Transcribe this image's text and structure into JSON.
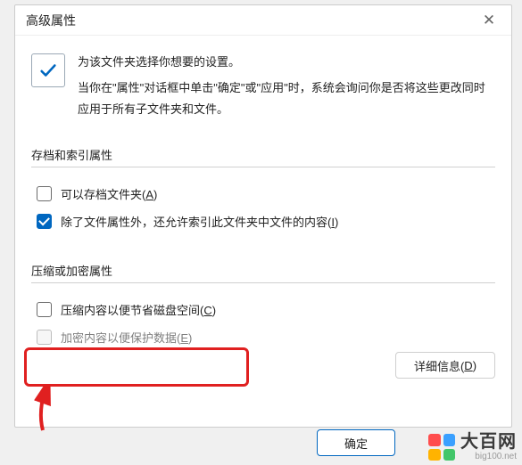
{
  "dialog": {
    "title": "高级属性",
    "intro_line1": "为该文件夹选择你想要的设置。",
    "intro_line2": "当你在\"属性\"对话框中单击\"确定\"或\"应用\"时，系统会询问你是否将这些更改同时应用于所有子文件夹和文件。"
  },
  "group1": {
    "label": "存档和索引属性",
    "chk1": {
      "text": "可以存档文件夹(",
      "accel": "A",
      "suffix": ")",
      "checked": false
    },
    "chk2": {
      "text": "除了文件属性外，还允许索引此文件夹中文件的内容(",
      "accel": "I",
      "suffix": ")",
      "checked": true
    }
  },
  "group2": {
    "label": "压缩或加密属性",
    "chk3": {
      "text": "压缩内容以便节省磁盘空间(",
      "accel": "C",
      "suffix": ")",
      "checked": false
    },
    "chk4": {
      "text": "加密内容以便保护数据(",
      "accel": "E",
      "suffix": ")",
      "checked": false,
      "disabled": true
    }
  },
  "buttons": {
    "details": {
      "text": "详细信息(",
      "accel": "D",
      "suffix": ")"
    },
    "ok": "确定"
  },
  "watermark": {
    "brand": "大百网",
    "url": "big100.net"
  }
}
